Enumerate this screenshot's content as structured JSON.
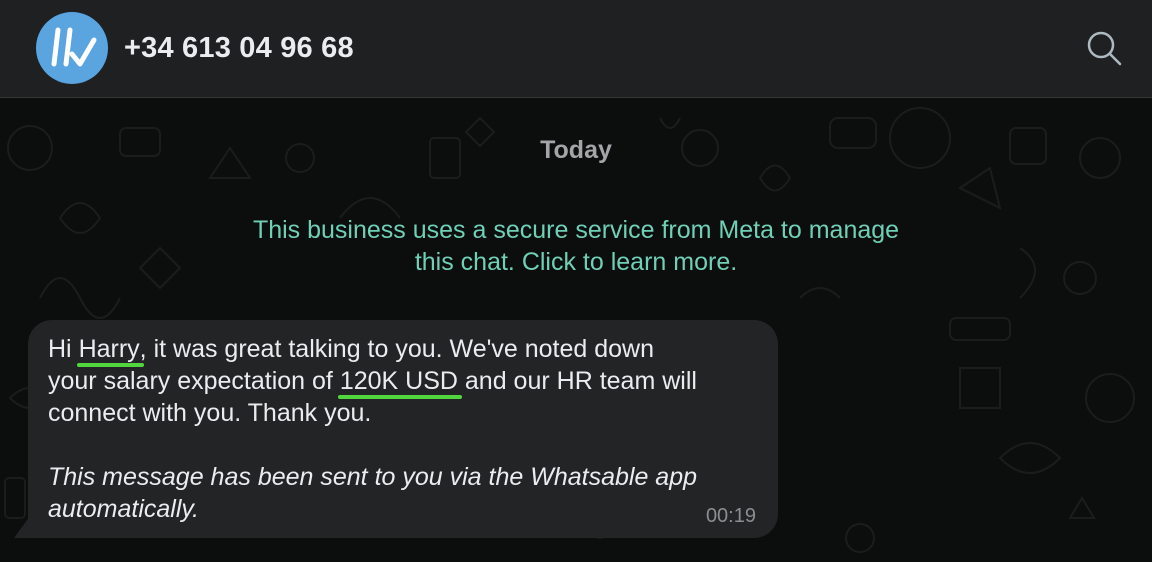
{
  "header": {
    "contact_name": "+34 613 04 96 68",
    "avatar_icon": "whatsable-logo-icon",
    "search_icon": "search-icon"
  },
  "chat": {
    "date_separator": "Today",
    "system_notice_line1": "This business uses a secure service from Meta to manage",
    "system_notice_line2": "this chat. Click to learn more.",
    "message": {
      "greeting": "Hi ",
      "name": "Harry",
      "part1": ", it was great talking to you. We've noted down",
      "part2": "your salary expectation of ",
      "amount": "120K USD",
      "part3": " and our HR team will",
      "part4": "connect with you. Thank you.",
      "note_line1": "This message has been sent to you via the Whatsable app",
      "note_line2": "automatically.",
      "time": "00:19"
    }
  },
  "colors": {
    "header_bg": "#1f2021",
    "chat_bg": "#0c0d0d",
    "bubble_bg": "#232425",
    "notice_text": "#6fd0b5",
    "highlight_underline": "#52d63e",
    "avatar_bg": "#5aa4e0"
  }
}
